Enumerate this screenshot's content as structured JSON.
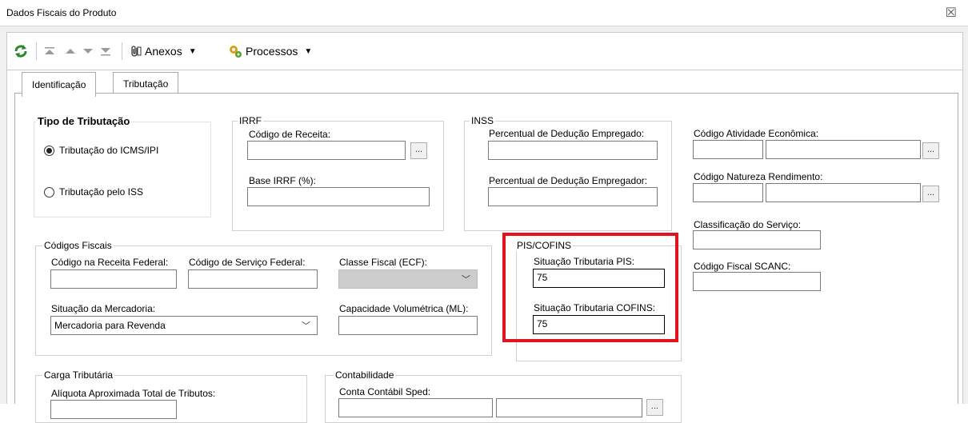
{
  "window": {
    "title": "Dados Fiscais do Produto",
    "close_glyph": "☒"
  },
  "toolbar": {
    "annexes_label": "Anexos",
    "processes_label": "Processos"
  },
  "tabs": [
    {
      "label": "Identificação"
    },
    {
      "label": "Tributação"
    }
  ],
  "tipo_tributacao": {
    "title": "Tipo de Tributação",
    "options": [
      {
        "label": "Tributação do ICMS/IPI",
        "selected": true
      },
      {
        "label": "Tributação pelo ISS",
        "selected": false
      }
    ]
  },
  "irrf": {
    "title": "IRRF",
    "codigo_receita_label": "Código de Receita:",
    "codigo_receita_value": "",
    "base_label": "Base IRRF (%):",
    "base_value": ""
  },
  "inss": {
    "title": "INSS",
    "empregado_label": "Percentual de Dedução Empregado:",
    "empregador_label": "Percentual de Dedução Empregador:"
  },
  "right_fields": {
    "atividade_label": "Código Atividade Econômica:",
    "natureza_label": "Código Natureza Rendimento:",
    "classificacao_label": "Classificação do Serviço:",
    "scanc_label": "Código Fiscal SCANC:"
  },
  "codigos_fiscais": {
    "title": "Códigos Fiscais",
    "receita_federal_label": "Código na Receita Federal:",
    "servico_federal_label": "Código de Serviço Federal:",
    "classe_fiscal_label": "Classe Fiscal (ECF):",
    "situacao_mercadoria_label": "Situação da Mercadoria:",
    "situacao_mercadoria_value": "Mercadoria para Revenda",
    "capacidade_label": "Capacidade Volumétrica (ML):"
  },
  "pis_cofins": {
    "title": "PIS/COFINS",
    "pis_label": "Situação Tributaria PIS:",
    "pis_value": "75",
    "cofins_label": "Situação Tributaria COFINS:",
    "cofins_value": "75",
    "highlight_color": "#e3131d"
  },
  "carga_tributaria": {
    "title": "Carga Tributária",
    "aliquota_label": "Alíquota Aproximada Total de Tributos:"
  },
  "contabilidade": {
    "title": "Contabilidade",
    "conta_label": "Conta Contábil Sped:"
  },
  "ellipsis": "..."
}
